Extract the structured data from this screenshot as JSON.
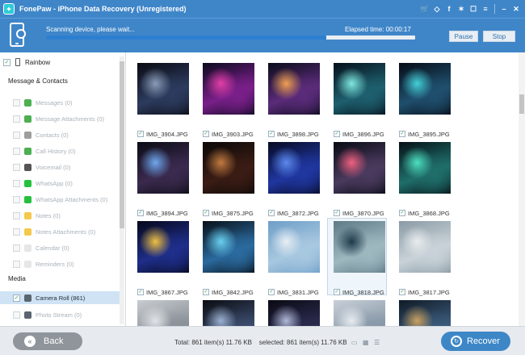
{
  "window": {
    "title": "FonePaw - iPhone Data Recovery (Unregistered)",
    "titlebar_icons": [
      "cart-icon",
      "diamond-icon",
      "facebook-icon",
      "twitter-icon",
      "chat-icon",
      "menu-icon",
      "minimize-icon",
      "close-icon"
    ]
  },
  "scan": {
    "status": "Scanning device, please wait...",
    "elapsed": "Elapsed time: 00:00:17",
    "progress": 0.76,
    "pause_label": "Pause",
    "stop_label": "Stop"
  },
  "sidebar": {
    "device": "Rainbow",
    "section_messages": "Message & Contacts",
    "messages_items": [
      {
        "label": "Messages (0)",
        "icon": "message-icon",
        "color": "#4caf50"
      },
      {
        "label": "Message Attachments (0)",
        "icon": "message-attachment-icon",
        "color": "#4caf50"
      },
      {
        "label": "Contacts (0)",
        "icon": "contacts-icon",
        "color": "#9e9e9e"
      },
      {
        "label": "Call History (0)",
        "icon": "phone-icon",
        "color": "#4caf50"
      },
      {
        "label": "Voicemail (0)",
        "icon": "voicemail-icon",
        "color": "#555555"
      },
      {
        "label": "WhatsApp (0)",
        "icon": "whatsapp-icon",
        "color": "#25c13e"
      },
      {
        "label": "WhatsApp Attachments (0)",
        "icon": "whatsapp-attachment-icon",
        "color": "#25c13e"
      },
      {
        "label": "Notes (0)",
        "icon": "notes-icon",
        "color": "#f5c84b"
      },
      {
        "label": "Notes Attachments (0)",
        "icon": "notes-attachment-icon",
        "color": "#f5c84b"
      },
      {
        "label": "Calendar (0)",
        "icon": "calendar-icon",
        "color": "#e6e6e6"
      },
      {
        "label": "Reminders (0)",
        "icon": "reminders-icon",
        "color": "#e6e6e6"
      }
    ],
    "section_media": "Media",
    "media_items": [
      {
        "label": "Camera Roll (861)",
        "icon": "camera-roll-icon",
        "color": "#5a6570",
        "selected": true
      },
      {
        "label": "Photo Stream (0)",
        "icon": "photo-stream-icon",
        "color": "#5a6570",
        "selected": false
      }
    ]
  },
  "photos": [
    {
      "name": "IMG_3904.JPG",
      "colors": [
        "#0a0a12",
        "#2c3b5e",
        "#8a9bb8"
      ]
    },
    {
      "name": "IMG_3903.JPG",
      "colors": [
        "#0b0a1e",
        "#7a1f8a",
        "#e23fa8"
      ]
    },
    {
      "name": "IMG_3898.JPG",
      "colors": [
        "#0a0c1a",
        "#5b2b7a",
        "#f0a050"
      ]
    },
    {
      "name": "IMG_3896.JPG",
      "colors": [
        "#05101a",
        "#1e5f6e",
        "#7fe8e0"
      ]
    },
    {
      "name": "IMG_3895.JPG",
      "colors": [
        "#070c16",
        "#1f4f6e",
        "#43d0d8"
      ]
    },
    {
      "name": "IMG_3894.JPG",
      "colors": [
        "#0b0b14",
        "#3a2a4e",
        "#6fa8f0"
      ]
    },
    {
      "name": "IMG_3875.JPG",
      "colors": [
        "#0a0808",
        "#3a1c14",
        "#c07a40"
      ]
    },
    {
      "name": "IMG_3872.JPG",
      "colors": [
        "#060a22",
        "#2036a0",
        "#5b8af0"
      ]
    },
    {
      "name": "IMG_3870.JPG",
      "colors": [
        "#080a14",
        "#4a3a5e",
        "#f06080"
      ]
    },
    {
      "name": "IMG_3868.JPG",
      "colors": [
        "#061016",
        "#1f6e6a",
        "#4de0c0"
      ]
    },
    {
      "name": "IMG_3867.JPG",
      "colors": [
        "#06081a",
        "#1e2e8a",
        "#f0c040"
      ]
    },
    {
      "name": "IMG_3842.JPG",
      "colors": [
        "#081018",
        "#2a6a9e",
        "#6ad0f0"
      ]
    },
    {
      "name": "IMG_3831.JPG",
      "colors": [
        "#6e9ec8",
        "#a8c8e0",
        "#e8eef4"
      ]
    },
    {
      "name": "IMG_3818.JPG",
      "colors": [
        "#5e7a86",
        "#9eb8c0",
        "#1e3a4a"
      ]
    },
    {
      "name": "IMG_3817.JPG",
      "colors": [
        "#8a9aa4",
        "#c8d2d8",
        "#e8ecee"
      ]
    },
    {
      "name": "",
      "colors": [
        "#c8ccd0",
        "#8a9098",
        "#e0e4e8"
      ]
    },
    {
      "name": "",
      "colors": [
        "#0a0c12",
        "#3a4a6a",
        "#9ab0d0"
      ]
    },
    {
      "name": "",
      "colors": [
        "#0a0a14",
        "#2a2a4e",
        "#b0b8d8"
      ]
    },
    {
      "name": "",
      "colors": [
        "#c8d0d8",
        "#8898a8",
        "#e8ecf0"
      ]
    },
    {
      "name": "",
      "colors": [
        "#101a26",
        "#3a5a7a",
        "#c8a060"
      ]
    }
  ],
  "footer": {
    "back_label": "Back",
    "summary": "Total: 861 item(s) 11.76 KB    selected: 861 item(s) 11.76 KB",
    "recover_label": "Recover"
  }
}
